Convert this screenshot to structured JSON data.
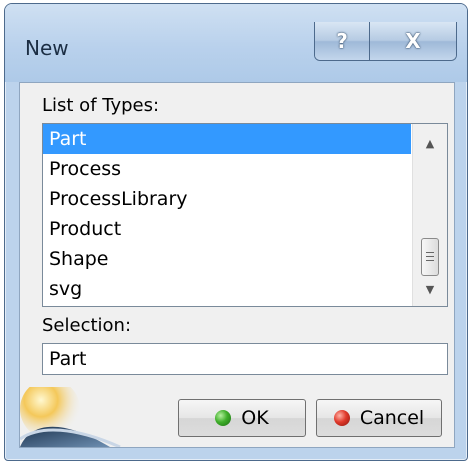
{
  "window": {
    "title": "New"
  },
  "caption": {
    "help": "?",
    "close": "X"
  },
  "list": {
    "label": "List of Types:",
    "items": [
      {
        "label": "Part",
        "selected": true
      },
      {
        "label": "Process"
      },
      {
        "label": "ProcessLibrary"
      },
      {
        "label": "Product"
      },
      {
        "label": "Shape"
      },
      {
        "label": "svg"
      }
    ],
    "scroll_up_icon": "scroll-up-arrow",
    "scroll_down_icon": "scroll-down-arrow"
  },
  "selection": {
    "label": "Selection:",
    "value": "Part"
  },
  "buttons": {
    "ok": "OK",
    "cancel": "Cancel"
  },
  "colors": {
    "selected_bg": "#3399ff",
    "ok_icon": "#3fae2a",
    "cancel_icon": "#e0392b"
  }
}
